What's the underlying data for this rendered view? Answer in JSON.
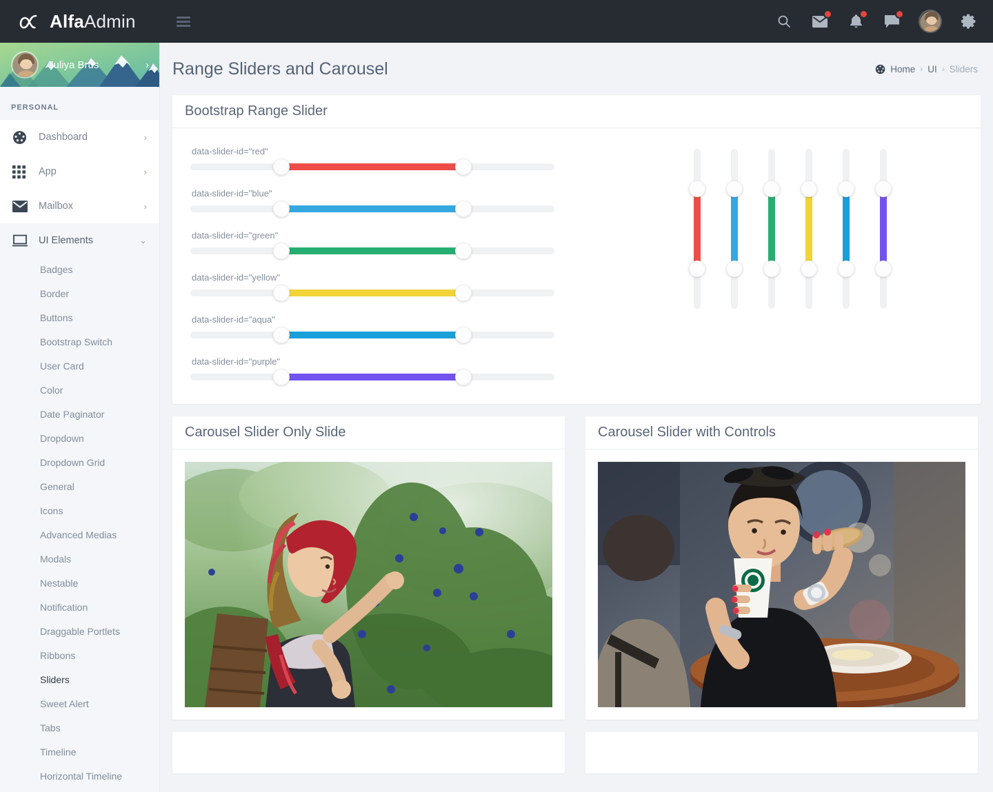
{
  "app": {
    "brand_bold": "Alfa",
    "brand_light": "Admin",
    "logo_icon": "alpha-logo-icon",
    "menu_toggle_icon": "hamburger-icon"
  },
  "topbar": {
    "icons": [
      {
        "name": "search-icon",
        "badge": false
      },
      {
        "name": "envelope-icon",
        "badge": true
      },
      {
        "name": "bell-icon",
        "badge": true
      },
      {
        "name": "chat-icon",
        "badge": true
      }
    ],
    "avatar_name": "user-avatar",
    "settings_icon": "gear-icon",
    "badge_color": "#e8453c",
    "background": "#272c33"
  },
  "sidebar": {
    "profile": {
      "name": "Juliya Brus",
      "arrow": "›",
      "avatar_name": "profile-avatar"
    },
    "section_label": "PERSONAL",
    "items": [
      {
        "label": "Dashboard",
        "icon": "dashboard-icon",
        "caret": "›",
        "active": false
      },
      {
        "label": "App",
        "icon": "grid-icon",
        "caret": "›",
        "active": false
      },
      {
        "label": "Mailbox",
        "icon": "mail-icon",
        "caret": "›",
        "active": false
      },
      {
        "label": "UI Elements",
        "icon": "monitor-icon",
        "caret": "⌄",
        "active": true
      }
    ],
    "sub_items": [
      {
        "label": "Badges",
        "current": false
      },
      {
        "label": "Border",
        "current": false
      },
      {
        "label": "Buttons",
        "current": false
      },
      {
        "label": "Bootstrap Switch",
        "current": false
      },
      {
        "label": "User Card",
        "current": false
      },
      {
        "label": "Color",
        "current": false
      },
      {
        "label": "Date Paginator",
        "current": false
      },
      {
        "label": "Dropdown",
        "current": false
      },
      {
        "label": "Dropdown Grid",
        "current": false
      },
      {
        "label": "General",
        "current": false
      },
      {
        "label": "Icons",
        "current": false
      },
      {
        "label": "Advanced Medias",
        "current": false
      },
      {
        "label": "Modals",
        "current": false
      },
      {
        "label": "Nestable",
        "current": false
      },
      {
        "label": "Notification",
        "current": false
      },
      {
        "label": "Draggable Portlets",
        "current": false
      },
      {
        "label": "Ribbons",
        "current": false
      },
      {
        "label": "Sliders",
        "current": true
      },
      {
        "label": "Sweet Alert",
        "current": false
      },
      {
        "label": "Tabs",
        "current": false
      },
      {
        "label": "Timeline",
        "current": false
      },
      {
        "label": "Horizontal Timeline",
        "current": false
      }
    ]
  },
  "page": {
    "title": "Range Sliders and Carousel",
    "breadcrumb": {
      "icon": "dashboard-icon",
      "home": "Home",
      "sep": "›",
      "section": "UI",
      "current": "Sliders"
    }
  },
  "slider_card": {
    "title": "Bootstrap Range Slider",
    "horizontal": [
      {
        "label": "data-slider-id=\"red\"",
        "color": "#ec4e47",
        "start": 25,
        "end": 75
      },
      {
        "label": "data-slider-id=\"blue\"",
        "color": "#35a9df",
        "start": 25,
        "end": 75
      },
      {
        "label": "data-slider-id=\"green\"",
        "color": "#27ae72",
        "start": 25,
        "end": 75
      },
      {
        "label": "data-slider-id=\"yellow\"",
        "color": "#f2d338",
        "start": 25,
        "end": 75
      },
      {
        "label": "data-slider-id=\"aqua\"",
        "color": "#1a9fd9",
        "start": 25,
        "end": 75
      },
      {
        "label": "data-slider-id=\"purple\"",
        "color": "#7253ef",
        "start": 25,
        "end": 75
      }
    ],
    "vertical": [
      {
        "name": "vertical-slider-red",
        "color": "#ec4e47",
        "start": 25,
        "end": 75
      },
      {
        "name": "vertical-slider-blue",
        "color": "#35a9df",
        "start": 25,
        "end": 75
      },
      {
        "name": "vertical-slider-green",
        "color": "#27ae72",
        "start": 25,
        "end": 75
      },
      {
        "name": "vertical-slider-yellow",
        "color": "#f2d338",
        "start": 25,
        "end": 75
      },
      {
        "name": "vertical-slider-aqua",
        "color": "#1a9fd9",
        "start": 25,
        "end": 75
      },
      {
        "name": "vertical-slider-purple",
        "color": "#7253ef",
        "start": 25,
        "end": 75
      }
    ]
  },
  "carousels": [
    {
      "title": "Carousel Slider Only Slide",
      "image": "woman-harvesting-blue-pea-flowers"
    },
    {
      "title": "Carousel Slider with Controls",
      "image": "woman-with-coffee-cup-in-cafe"
    }
  ]
}
